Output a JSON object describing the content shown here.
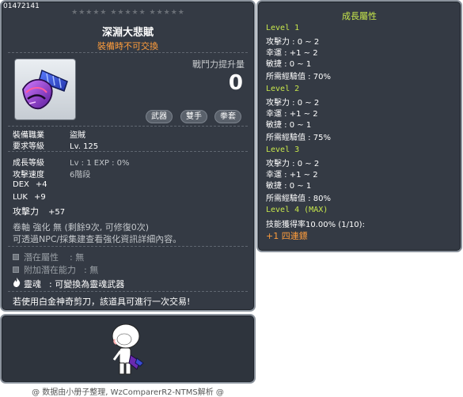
{
  "item": {
    "id": "01472141",
    "stars": "★★★★★  ★★★★★  ★★★★★",
    "name": "深淵大悲賦",
    "trade_note": "裝備時不可交換",
    "power_label": "戰鬥力提升量",
    "power_value": "0",
    "tags": [
      "武器",
      "雙手",
      "拳套"
    ],
    "job_label": "裝備職業",
    "job_value": "盜賊",
    "req_level_label": "要求等級",
    "req_level_value": "Lv. 125",
    "growth_level_label": "成長等級",
    "growth_level_value": "Lv  :  1    EXP  :  0%",
    "attack_speed_label": "攻擊速度",
    "attack_speed_value": "6階段",
    "stats": [
      {
        "key": "DEX",
        "value": "+4"
      },
      {
        "key": "LUK",
        "value": "+9"
      },
      {
        "key": "攻擊力",
        "value": "+57"
      }
    ],
    "scroll_line": "卷軸 強化 無 (剩餘9次, 可修復0次)",
    "enhance_note": "可透過NPC/採集建查看強化資訊詳細內容。",
    "potential_label": "潛在屬性",
    "potential_value": ":  無",
    "extra_potential_label": "附加潛在能力",
    "extra_potential_value": ":  無",
    "soul_label": "靈魂",
    "soul_value": ":  可變換為靈魂武器",
    "scissors_note": "若使用白金神奇剪刀，該道具可進行一次交易!"
  },
  "growth": {
    "title": "成長屬性",
    "levels": [
      {
        "label": "Level 1",
        "lines": [
          "攻擊力 : 0 ~ 2",
          "幸運 : +1 ~ 2",
          "敏捷 : 0 ~ 1",
          "所需經驗值 : 70%"
        ]
      },
      {
        "label": "Level 2",
        "lines": [
          "攻擊力 : 0 ~ 2",
          "幸運 : +1 ~ 2",
          "敏捷 : 0 ~ 1",
          "所需經驗值 : 75%"
        ]
      },
      {
        "label": "Level 3",
        "lines": [
          "攻擊力 : 0 ~ 2",
          "幸運 : +1 ~ 2",
          "敏捷 : 0 ~ 1",
          "所需經驗值 : 80%"
        ]
      },
      {
        "label": "Level 4 (MAX)",
        "lines": [
          "技能獲得率10.00% (1/10):"
        ]
      }
    ],
    "skill": "+1 四連鏢"
  },
  "credit": "@ 数据由小册子整理, WzComparerR2-NTMS解析 @"
}
